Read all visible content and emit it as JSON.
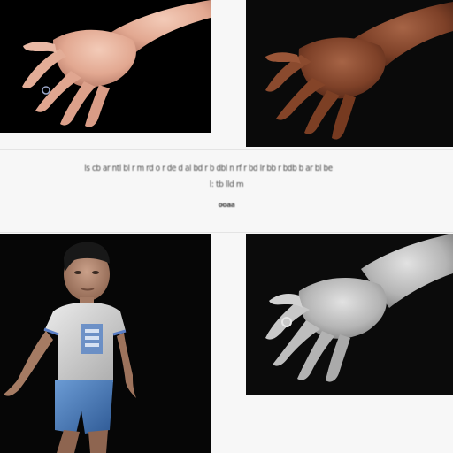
{
  "figure": {
    "caption_line_1": "ls cb ar ntl bl r m rd o r de d al bd r b dbl n rf r bd lr bb r bdb b ar bl be",
    "caption_line_2": "l: tb lld m",
    "caption_line_3": "ooaa",
    "panels": [
      {
        "id": "top-left",
        "subject": "hand",
        "tone": "light skin"
      },
      {
        "id": "top-right",
        "subject": "hand",
        "tone": "dark skin"
      },
      {
        "id": "bottom-left",
        "subject": "boy figure"
      },
      {
        "id": "bottom-right",
        "subject": "hand",
        "tone": "grayscale"
      }
    ],
    "colors": {
      "background": "#f7f7f7",
      "panel_background": "#000000",
      "skin_light": "#e7b8a4",
      "skin_dark": "#8a4a2e",
      "shirt": "#d9d9d9",
      "shorts": "#4a7fc0",
      "gray_hand": "#bdbdbd"
    }
  }
}
